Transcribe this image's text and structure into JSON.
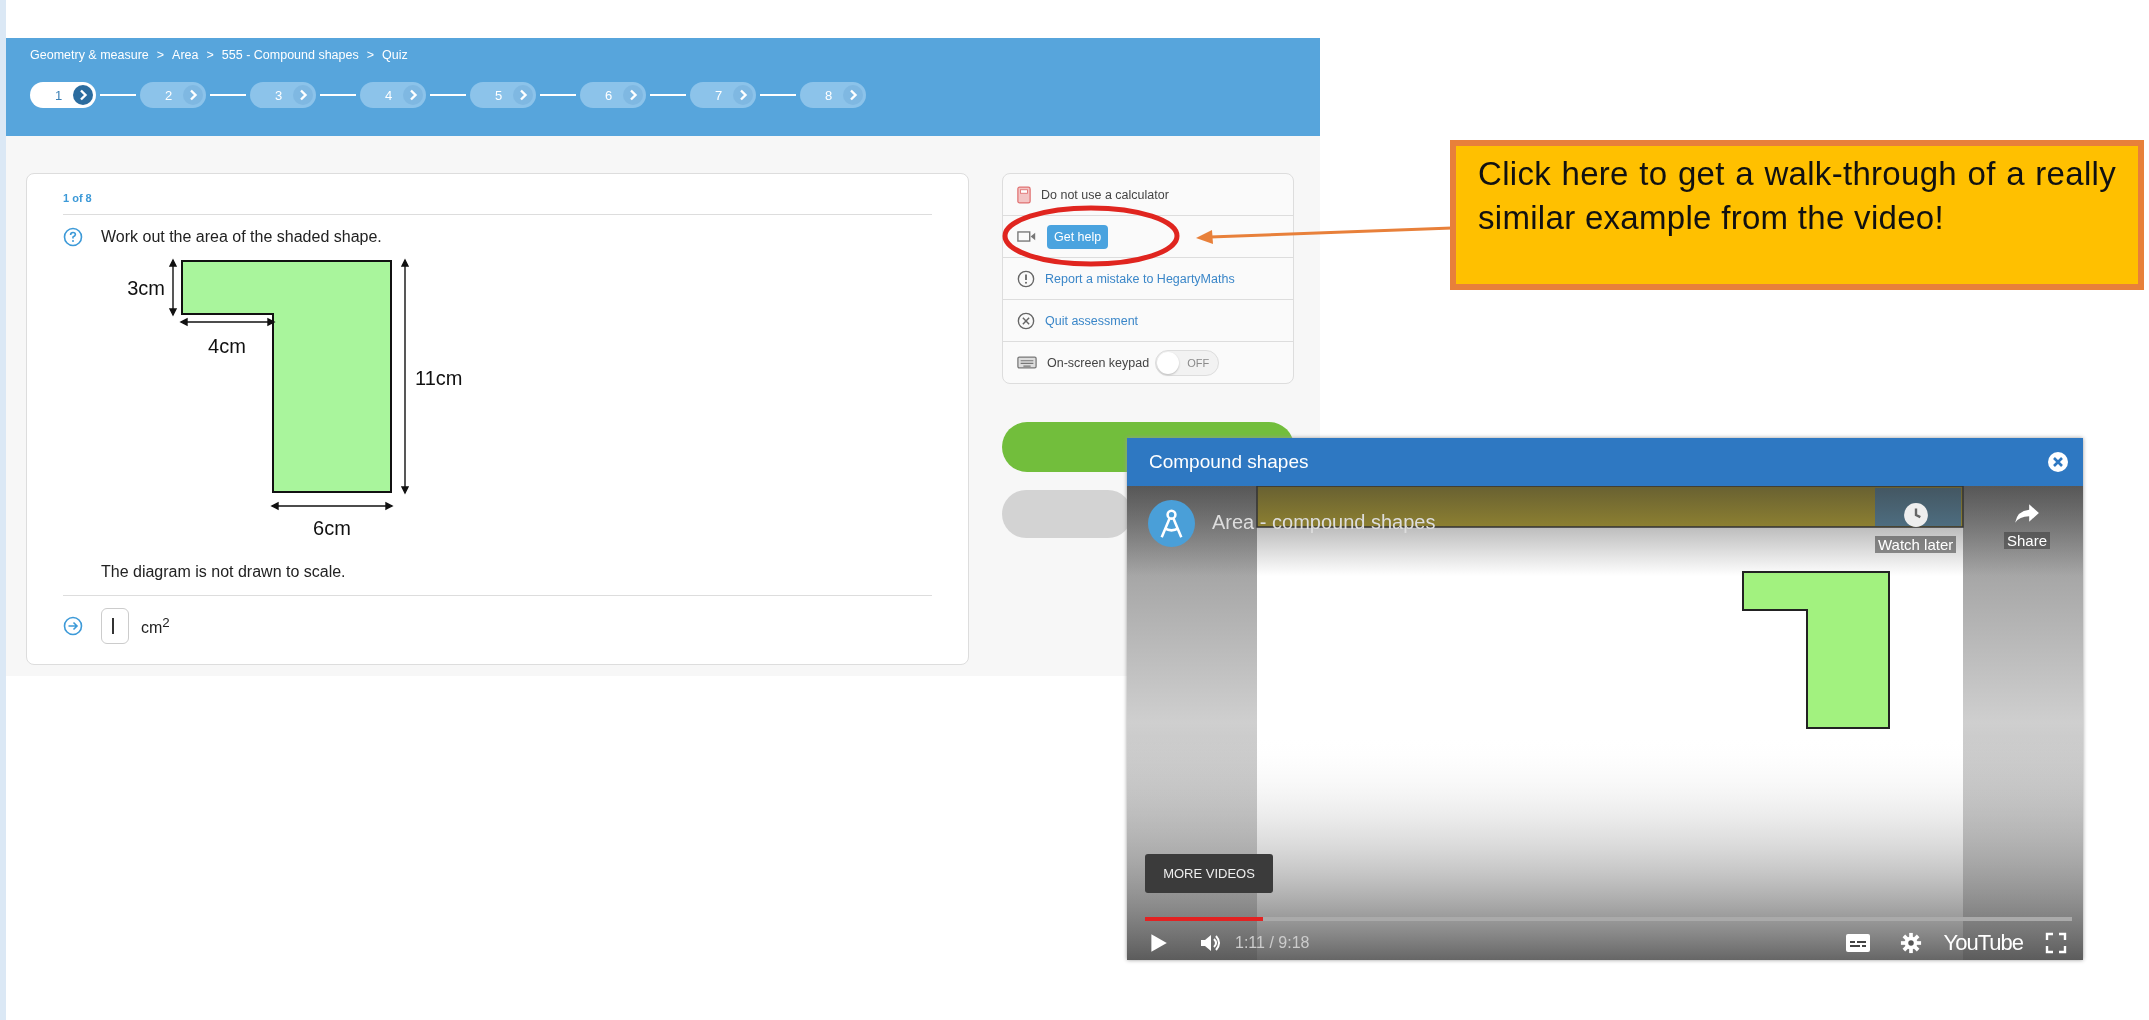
{
  "breadcrumb": [
    "Geometry & measure",
    ">",
    "Area",
    ">",
    "555 - Compound shapes",
    ">",
    "Quiz"
  ],
  "steps": [
    {
      "label": "1",
      "selected": true
    },
    {
      "label": "2",
      "selected": false
    },
    {
      "label": "3",
      "selected": false
    },
    {
      "label": "4",
      "selected": false
    },
    {
      "label": "5",
      "selected": false
    },
    {
      "label": "6",
      "selected": false
    },
    {
      "label": "7",
      "selected": false
    },
    {
      "label": "8",
      "selected": false
    }
  ],
  "question": {
    "counter": "1 of 8",
    "prompt": "Work out the area of the shaded shape.",
    "diagram_labels": {
      "left_height": "3cm",
      "step_width": "4cm",
      "total_height": "11cm",
      "base_width": "6cm"
    },
    "note": "The diagram is not drawn to scale.",
    "answer": {
      "unit": "cm$^{2}$"
    }
  },
  "side_panel": [
    {
      "kind": "note",
      "label": "Do not use a calculator"
    },
    {
      "kind": "help",
      "label": "Get help"
    },
    {
      "kind": "report",
      "label": "Report a mistake to HegartyMaths"
    },
    {
      "kind": "quit",
      "label": "Quit assessment"
    },
    {
      "kind": "keypad",
      "label": "On-screen keypad",
      "toggle": {
        "label": "OFF",
        "on": false
      }
    }
  ],
  "callout": {
    "text": "Click here to get a walk-through of a really similar example from the video!"
  },
  "video_dialog": {
    "title": "Compound shapes",
    "player": {
      "video_title": "Area - compound shapes",
      "actions": [
        "Watch later",
        "Share"
      ],
      "more_videos": "MORE VIDEOS",
      "level": 0.127,
      "time": "1:11 / 9:18",
      "brand": "YouTube"
    }
  }
}
